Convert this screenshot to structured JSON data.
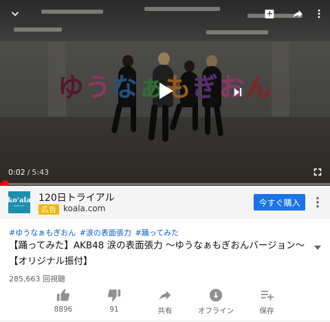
{
  "player": {
    "video_title_chars": [
      "ゆ",
      "う",
      "な",
      "ぁ",
      "も",
      "ぎ",
      "お",
      "ん"
    ],
    "current_time": "0:02",
    "separator": "/",
    "duration": "5:43",
    "progress_fraction": 0.006,
    "icons": {
      "collapse": "chevron-down-icon",
      "add_to_playlist": "playlist-add-icon",
      "share": "share-icon",
      "more": "more-vert-icon",
      "play": "play-icon",
      "next": "skip-next-icon",
      "fullscreen": "fullscreen-icon"
    }
  },
  "ad": {
    "logo_text": "ko'ala",
    "logo_subtext": "koala.com",
    "title": "120日トライアル",
    "badge": "広告",
    "domain": "koala.com",
    "cta": "今すぐ購入"
  },
  "video": {
    "tags": [
      "#ゆうなぁもぎおん",
      "#涙の表面張力",
      "#踊ってみた"
    ],
    "title_line1": "【踊ってみた】AKB48 涙の表面張力 〜ゆうなぁもぎおんバージョン〜",
    "title_line2": "【オリジナル振付】",
    "views": "285,663 回視聴"
  },
  "actions": [
    {
      "label": "8896",
      "icon": "thumb-up-icon"
    },
    {
      "label": "91",
      "icon": "thumb-down-icon"
    },
    {
      "label": "共有",
      "icon": "share-icon"
    },
    {
      "label": "オフライン",
      "icon": "download-icon"
    },
    {
      "label": "保存",
      "icon": "playlist-add-icon"
    }
  ]
}
